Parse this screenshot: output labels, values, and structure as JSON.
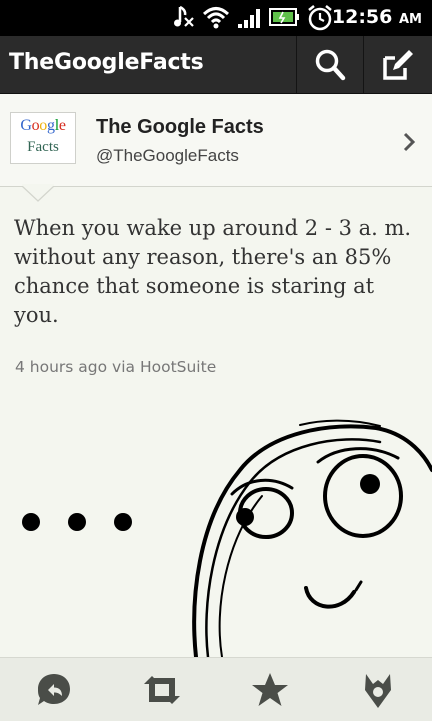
{
  "status_bar": {
    "time": "12:56",
    "ampm": "AM",
    "icons": [
      "music-muted-icon",
      "wifi-icon",
      "signal-icon",
      "battery-icon",
      "alarm-icon"
    ]
  },
  "app_bar": {
    "title": "TheGoogleFacts",
    "actions": [
      "search-icon",
      "compose-icon"
    ]
  },
  "profile": {
    "logo_line1": "Google",
    "logo_line2": "Facts",
    "name": "The Google Facts",
    "handle": "@TheGoogleFacts"
  },
  "tweet": {
    "text": "When you wake up around 2 - 3 a. m. without any reason, there's an 85% chance that someone is staring at you.",
    "meta": "4 hours ago via HootSuite",
    "image_caption_text": "• • •"
  },
  "toolbar": {
    "actions": [
      "reply-icon",
      "retweet-icon",
      "favorite-icon",
      "more-icon"
    ]
  },
  "colors": {
    "statusbar": "#000000",
    "appbar": "#2b2b2b",
    "background": "#f4f6ef",
    "google_blue": "#3366cc",
    "google_red": "#d62d20",
    "google_yellow": "#eeb211",
    "google_green": "#009925"
  }
}
